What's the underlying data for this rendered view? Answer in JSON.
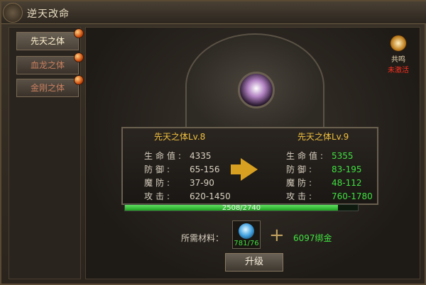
{
  "window": {
    "title": "逆天改命"
  },
  "tabs": [
    {
      "label": "先天之体"
    },
    {
      "label": "血龙之体"
    },
    {
      "label": "金刚之体"
    }
  ],
  "resonance": {
    "title": "共鸣",
    "status": "未激活"
  },
  "current": {
    "level_label": "先天之体Lv.8",
    "stats": [
      {
        "label": "生命值:",
        "value": "4335"
      },
      {
        "label": "防御:",
        "value": "65-156"
      },
      {
        "label": "魔防:",
        "value": "37-90"
      },
      {
        "label": "攻击:",
        "value": "620-1450"
      }
    ]
  },
  "next": {
    "level_label": "先天之体Lv.9",
    "stats": [
      {
        "label": "生命值:",
        "value": "5355"
      },
      {
        "label": "防御:",
        "value": "83-195"
      },
      {
        "label": "魔防:",
        "value": "48-112"
      },
      {
        "label": "攻击:",
        "value": "760-1780"
      }
    ]
  },
  "progress": {
    "text": "2508/2740",
    "fraction": 0.915
  },
  "materials": {
    "label": "所需材料：",
    "item_count": "781/76",
    "gold": "6097绑金"
  },
  "upgrade_label": "升级"
}
